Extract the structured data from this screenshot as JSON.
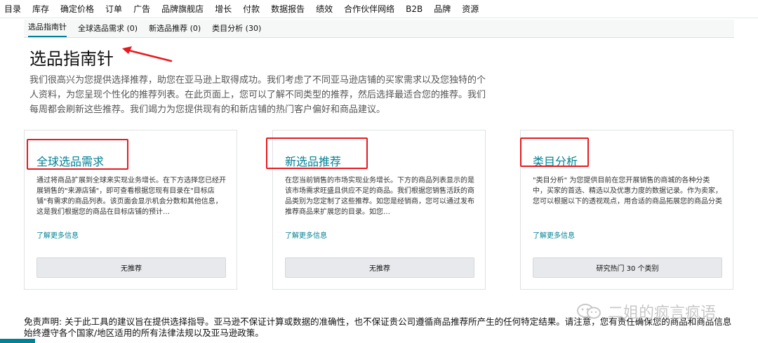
{
  "topnav": {
    "items": [
      "目录",
      "库存",
      "确定价格",
      "订单",
      "广告",
      "品牌旗舰店",
      "增长",
      "付款",
      "数据报告",
      "绩效",
      "合作伙伴网络",
      "B2B",
      "品牌",
      "资源"
    ]
  },
  "subtabs": {
    "items": [
      "选品指南针",
      "全球选品需求 (0)",
      "新选品推荐 (0)",
      "类目分析 (30)"
    ],
    "active_index": 0
  },
  "page": {
    "title": "选品指南针",
    "intro": "我们很高兴为您提供选择推荐，助您在亚马逊上取得成功。我们考虑了不同亚马逊店铺的买家需求以及您独特的个人资料，为您呈现个性化的推荐列表。在此页面上，您可以了解不同类型的推荐，然后选择最适合您的推荐。我们每周都会刷新这些推荐。我们竭力为您提供现有的和新店铺的热门客户偏好和商品建议。"
  },
  "cards": [
    {
      "title": "全球选品需求",
      "desc": "通过将商品扩展到全球来实现业务增长。在下方选择您已经开展销售的\"来源店铺\"，即可查看根据您现有目录在\"目标店铺\"有需求的商品列表。该页面会显示机会分数和其他信息，这是我们根据您的商品在目标店铺的预计…",
      "link": "了解更多信息",
      "button": "无推荐"
    },
    {
      "title": "新选品推荐",
      "desc": "在您当前销售的市场实现业务增长。下方的商品列表显示的是该市场需求旺盛且供应不足的商品。我们根据您销售活跃的商品类别为您定制了这些推荐。如您是经销商，您可以通过发布推荐商品来扩展您的目录。如您…",
      "link": "了解更多信息",
      "button": "无推荐"
    },
    {
      "title": "类目分析",
      "desc": "\"类目分析\" 为您提供目前在您开展销售的商城的各种分类中，买家的首选、精选以及优惠力度的数据记录。作为卖家，您可以根据以下的透视观点，用合适的商品拓展您的商品分类",
      "link": "了解更多信息",
      "button": "研究热门 30 个类别"
    }
  ],
  "disclaimer": "免责声明: 关于此工具的建议旨在提供选择指导。亚马逊不保证计算或数据的准确性，也不保证贵公司遵循商品推荐所产生的任何特定结果。请注意，您有责任确保您的商品和商品信息始终遵守各个国家/地区适用的所有法律法规以及亚马逊政策。",
  "watermark": "二姐的疯言疯语",
  "colors": {
    "accent": "#008296",
    "annotation": "#e8191f",
    "button_bg": "#e7e9ec"
  }
}
